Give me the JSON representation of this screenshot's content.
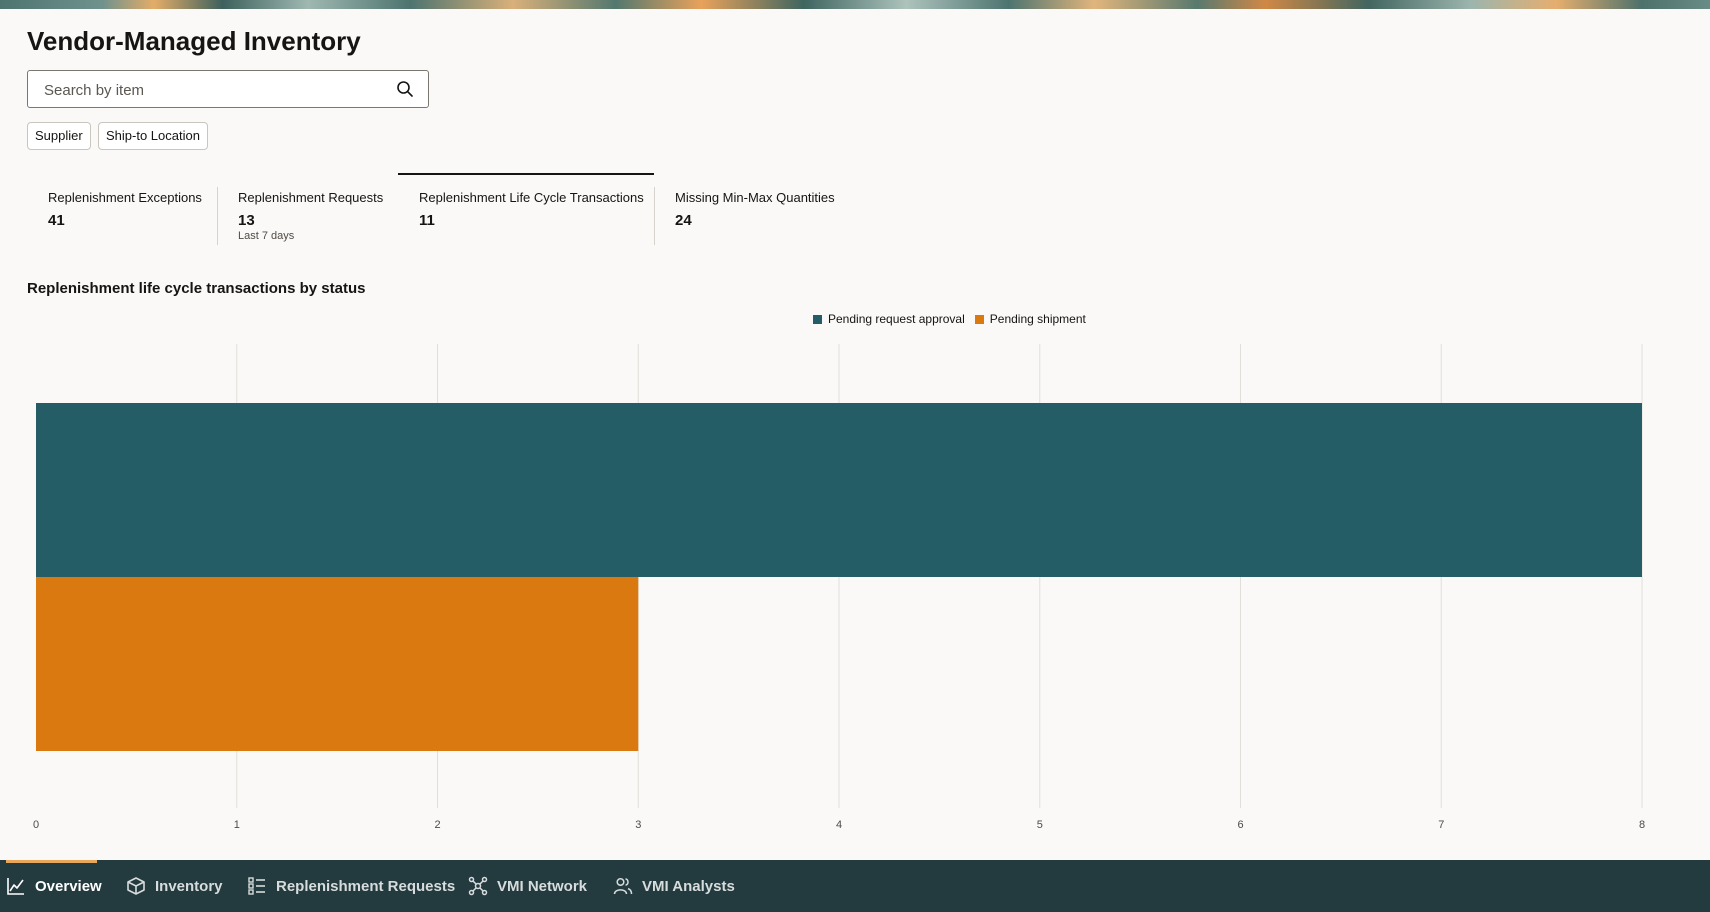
{
  "page": {
    "title": "Vendor-Managed Inventory"
  },
  "search": {
    "placeholder": "Search by item",
    "icon": "search-icon"
  },
  "filters": [
    {
      "label": "Supplier"
    },
    {
      "label": "Ship-to Location"
    }
  ],
  "kpis": [
    {
      "label": "Replenishment Exceptions",
      "value": "41"
    },
    {
      "label": "Replenishment Requests",
      "value": "13",
      "sub": "Last 7 days"
    },
    {
      "label": "Replenishment Life Cycle Transactions",
      "value": "11",
      "selected": true
    },
    {
      "label": "Missing Min-Max Quantities",
      "value": "24"
    }
  ],
  "chart_data": {
    "type": "bar",
    "orientation": "horizontal",
    "title": "Replenishment life cycle transactions by status",
    "series": [
      {
        "name": "Pending request approval",
        "value": 8,
        "color": "#255d67"
      },
      {
        "name": "Pending shipment",
        "value": 3,
        "color": "#d9790f"
      }
    ],
    "x_ticks": [
      "0",
      "1",
      "2",
      "3",
      "4",
      "5",
      "6",
      "7",
      "8"
    ],
    "xlim": [
      0,
      8
    ],
    "grid": true,
    "legend": "top-center"
  },
  "bottom_nav": {
    "items": [
      {
        "label": "Overview",
        "icon": "line-chart-icon",
        "active": true
      },
      {
        "label": "Inventory",
        "icon": "box-icon"
      },
      {
        "label": "Replenishment Requests",
        "icon": "list-icon"
      },
      {
        "label": "VMI Network",
        "icon": "network-icon"
      },
      {
        "label": "VMI Analysts",
        "icon": "users-icon"
      }
    ],
    "accent": "#e8a65a",
    "background": "#233a3f"
  }
}
